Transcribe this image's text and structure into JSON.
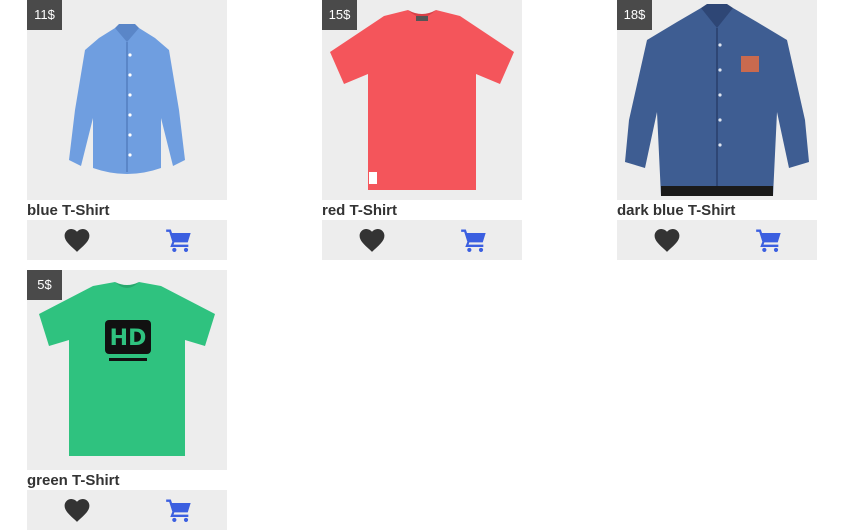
{
  "products": [
    {
      "price": "11$",
      "name": "blue T-Shirt",
      "color": "#6f9ee0",
      "icon": "long-sleeve-shirt-icon"
    },
    {
      "price": "15$",
      "name": "red T-Shirt",
      "color": "#f4555b",
      "icon": "t-shirt-icon"
    },
    {
      "price": "18$",
      "name": "dark blue T-Shirt",
      "color": "#3e5d92",
      "icon": "long-sleeve-shirt-icon"
    },
    {
      "price": "5$",
      "name": "green T-Shirt",
      "color": "#2fc27f",
      "icon": "t-shirt-icon",
      "logo_text": "HD"
    }
  ],
  "actions": {
    "favorite_icon": "heart-icon",
    "favorite_color": "#333333",
    "cart_icon": "shopping-cart-icon",
    "cart_color": "#3b5fe0"
  }
}
